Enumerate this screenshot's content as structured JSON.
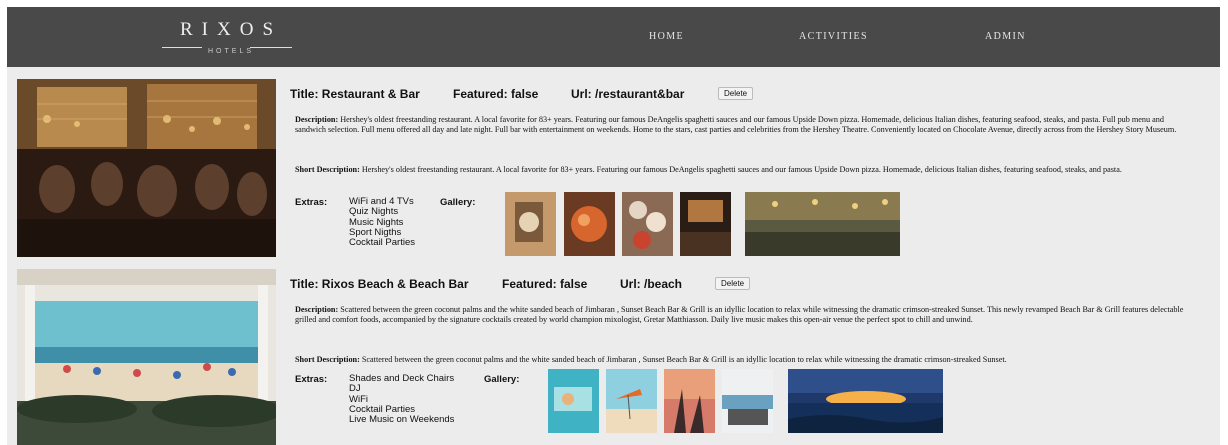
{
  "nav": {
    "logo_text": "RIXOS",
    "logo_sub": "HOTELS",
    "links": [
      "HOME",
      "ACTIVITIES",
      "ADMIN"
    ]
  },
  "labels": {
    "extras": "Extras:",
    "gallery": "Gallery:",
    "description": "Description:",
    "short_description": "Short Description:",
    "delete": "Delete"
  },
  "items": [
    {
      "title": "Title: Restaurant & Bar",
      "featured": "Featured: false",
      "url": "Url: /restaurant&bar",
      "description": "Hershey's oldest freestanding restaurant. A local favorite for 83+ years. Featuring our famous DeAngelis spaghetti sauces and our famous Upside Down pizza. Homemade, delicious Italian dishes, featuring seafood, steaks, and pasta. Full pub menu and sandwich selection. Full menu offered all day and late night. Full bar with entertainment on weekends. Home to the stars, cast parties and celebrities from the Hershey Theatre. Conveniently located on Chocolate Avenue, directly across from the Hershey Story Museum.",
      "short_description": "Hershey's oldest freestanding restaurant. A local favorite for 83+ years. Featuring our famous DeAngelis spaghetti sauces and our famous Upside Down pizza. Homemade, delicious Italian dishes, featuring seafood, steaks, and pasta.",
      "extras": [
        "WiFi and 4 TVs",
        "Quiz Nights",
        "Music Nights",
        "Sport Nigths",
        "Cocktail Parties"
      ]
    },
    {
      "title": "Title: Rixos Beach & Beach Bar",
      "featured": "Featured: false",
      "url": "Url: /beach",
      "description": "Scattered between the green coconut palms and the white sanded beach of Jimbaran , Sunset Beach Bar & Grill is an idyllic location to relax while witnessing the dramatic crimson-streaked Sunset. This newly revamped Beach Bar & Grill features delectable grilled and comfort foods, accompanied by the signature cocktails created by world champion mixologist, Gretar Matthiasson. Daily live music makes this open-air venue the perfect spot to chill and unwind.",
      "short_description": "Scattered between the green coconut palms and the white sanded beach of Jimbaran , Sunset Beach Bar & Grill is an idyllic location to relax while witnessing the dramatic crimson-streaked Sunset.",
      "extras": [
        "Shades and Deck Chairs",
        "DJ",
        "WiFi",
        "Cocktail Parties",
        "Live Music on Weekends"
      ]
    }
  ]
}
